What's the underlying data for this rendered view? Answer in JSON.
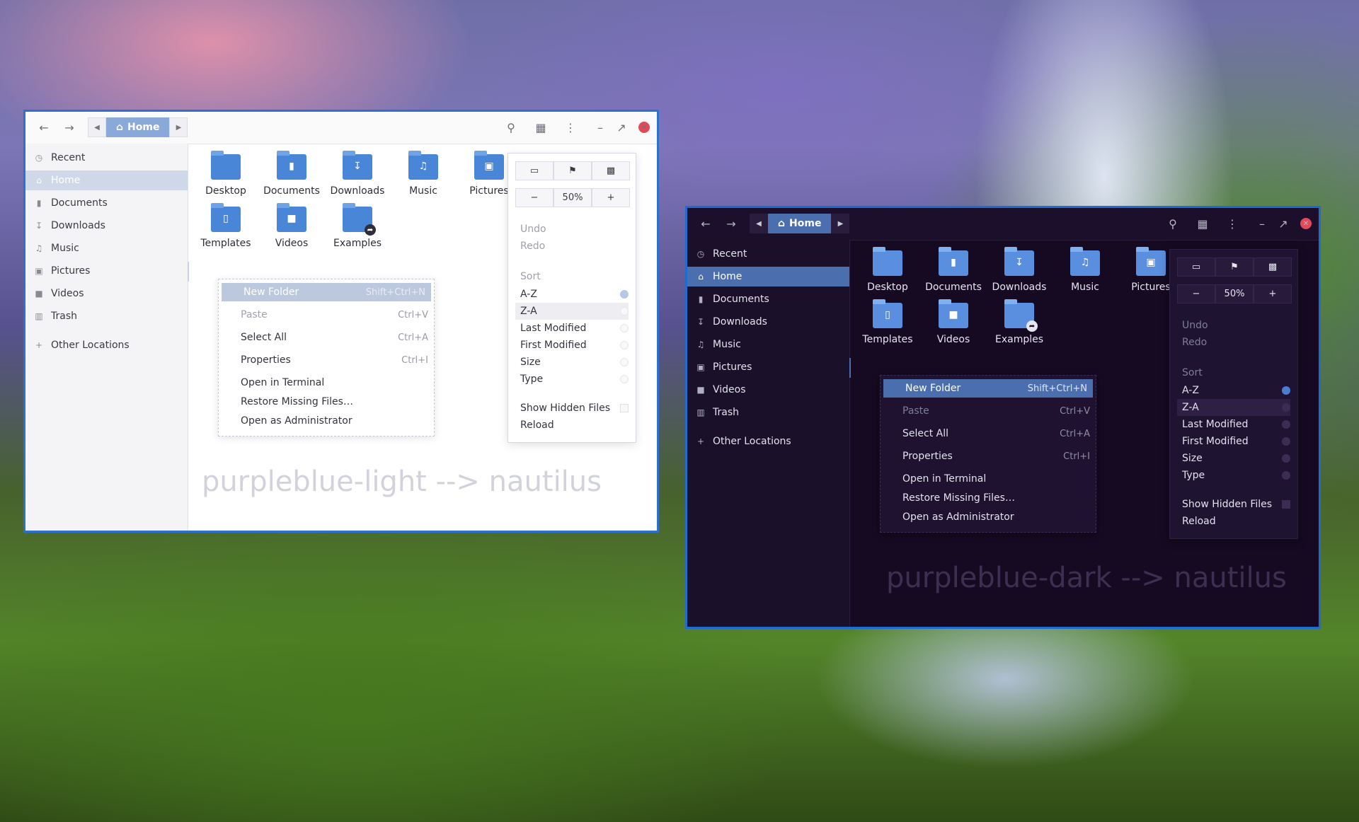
{
  "nav": {
    "home_crumb": "Home",
    "zoom_level": "50%"
  },
  "sidebar": {
    "items": [
      {
        "label": "Recent",
        "icon": "clock-icon"
      },
      {
        "label": "Home",
        "icon": "home-icon"
      },
      {
        "label": "Documents",
        "icon": "document-icon"
      },
      {
        "label": "Downloads",
        "icon": "download-icon"
      },
      {
        "label": "Music",
        "icon": "music-icon"
      },
      {
        "label": "Pictures",
        "icon": "picture-icon"
      },
      {
        "label": "Videos",
        "icon": "video-icon"
      },
      {
        "label": "Trash",
        "icon": "trash-icon"
      },
      {
        "label": "Other Locations",
        "icon": "plus-icon"
      }
    ]
  },
  "folders": [
    {
      "label": "Desktop",
      "icon": "desktop-folder-icon"
    },
    {
      "label": "Documents",
      "icon": "documents-folder-icon"
    },
    {
      "label": "Downloads",
      "icon": "downloads-folder-icon"
    },
    {
      "label": "Music",
      "icon": "music-folder-icon"
    },
    {
      "label": "Pictures",
      "icon": "pictures-folder-icon"
    },
    {
      "label": "Templates",
      "icon": "templates-folder-icon"
    },
    {
      "label": "Videos",
      "icon": "videos-folder-icon"
    },
    {
      "label": "Examples",
      "icon": "examples-folder-icon"
    }
  ],
  "context_menu": {
    "items": [
      {
        "label": "New Folder",
        "accel": "Shift+Ctrl+N"
      },
      {
        "label": "Paste",
        "accel": "Ctrl+V"
      },
      {
        "label": "Select All",
        "accel": "Ctrl+A"
      },
      {
        "label": "Properties",
        "accel": "Ctrl+I"
      },
      {
        "label": "Open in Terminal",
        "accel": ""
      },
      {
        "label": "Restore Missing Files…",
        "accel": ""
      },
      {
        "label": "Open as Administrator",
        "accel": ""
      }
    ]
  },
  "view_menu": {
    "undo": "Undo",
    "redo": "Redo",
    "sort_header": "Sort",
    "sort_options": [
      "A-Z",
      "Z-A",
      "Last Modified",
      "First Modified",
      "Size",
      "Type"
    ],
    "selected_sort": "A-Z",
    "show_hidden": "Show Hidden Files",
    "reload": "Reload"
  },
  "captions": {
    "light": "purpleblue-light --> nautilus",
    "dark": "purpleblue-dark --> nautilus"
  },
  "colors": {
    "accent_light": "#8aa8d8",
    "accent_dark": "#4b6fae",
    "folder_blue": "#4a86d8",
    "close_red": "#e24a5a",
    "window_border": "#2f6fd0"
  }
}
